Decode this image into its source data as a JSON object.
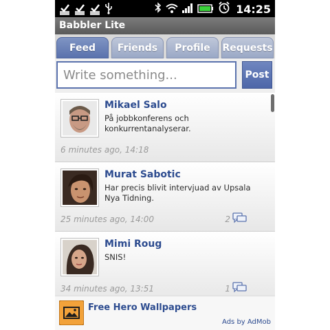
{
  "status_bar": {
    "time": "14:25",
    "icons": [
      "check-notification-icon",
      "check-notification-icon",
      "check-notification-icon",
      "usb-icon",
      "bluetooth-icon",
      "wifi-icon",
      "signal-icon",
      "battery-icon",
      "alarm-icon"
    ]
  },
  "app": {
    "title": "Babbler Lite"
  },
  "tabs": [
    {
      "label": "Feed",
      "active": true
    },
    {
      "label": "Friends",
      "active": false
    },
    {
      "label": "Profile",
      "active": false
    },
    {
      "label": "Requests",
      "active": false
    }
  ],
  "compose": {
    "placeholder": "Write something...",
    "post_label": "Post"
  },
  "feed": [
    {
      "name": "Mikael Salo",
      "text": "På jobbkonferens och konkurrentanalyserar.",
      "time": "6 minutes ago, 14:18",
      "comments": ""
    },
    {
      "name": "Murat Sabotic",
      "text": "Har precis blivit intervjuad av Upsala Nya Tidning.",
      "time": "25 minutes ago, 14:00",
      "comments": "2"
    },
    {
      "name": "Mimi Roug",
      "text": "SNIS!",
      "time": "34 minutes ago, 13:51",
      "comments": "1"
    }
  ],
  "ad": {
    "title": "Free Hero Wallpapers",
    "attribution": "Ads by AdMob",
    "icon": "wallpaper-icon"
  },
  "colors": {
    "accent": "#5a72ad",
    "name_text": "#2c4b8f",
    "tab_inactive": "#9aa8c6"
  }
}
